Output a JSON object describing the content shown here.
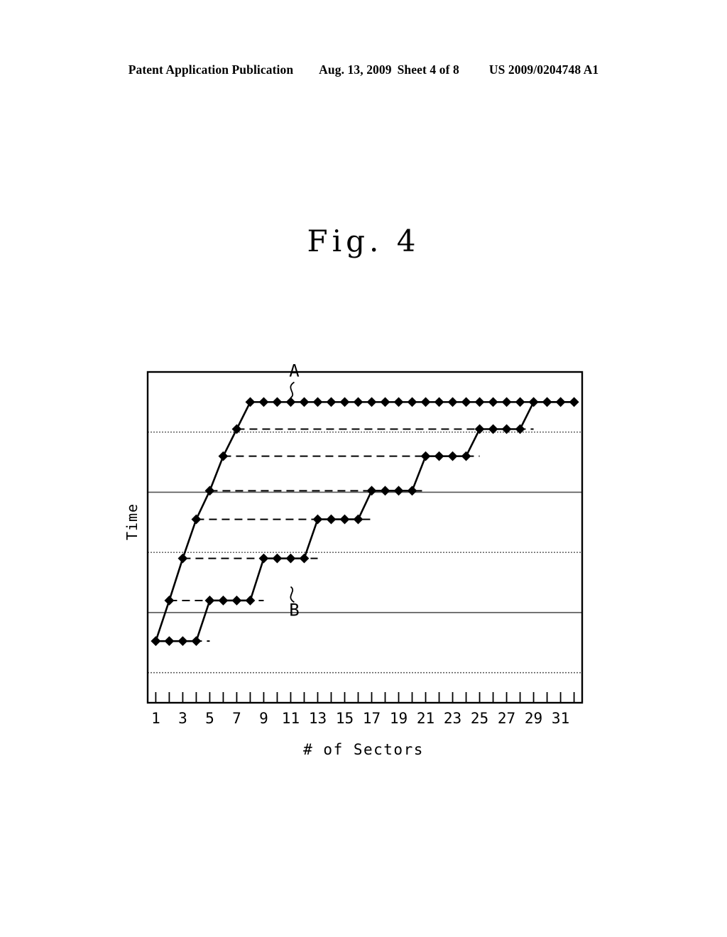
{
  "header": {
    "publication": "Patent Application Publication",
    "date": "Aug. 13, 2009",
    "sheet": "Sheet 4 of 8",
    "patent_number": "US 2009/0204748 A1"
  },
  "figure": {
    "title": "Fig. 4"
  },
  "chart_data": {
    "type": "line",
    "title": "Fig. 4",
    "xlabel": "# of Sectors",
    "ylabel": "Time",
    "xlim": [
      0.4,
      32.6
    ],
    "ylim": [
      0,
      11
    ],
    "grid": true,
    "grid_y": [
      1,
      3,
      5,
      7,
      9
    ],
    "xticks": [
      1,
      2,
      3,
      4,
      5,
      6,
      7,
      8,
      9,
      10,
      11,
      12,
      13,
      14,
      15,
      16,
      17,
      18,
      19,
      20,
      21,
      22,
      23,
      24,
      25,
      26,
      27,
      28,
      29,
      30,
      31,
      32
    ],
    "xticklabels": [
      "1",
      "",
      "3",
      "",
      "5",
      "",
      "7",
      "",
      "9",
      "",
      "11",
      "",
      "13",
      "",
      "15",
      "",
      "17",
      "",
      "19",
      "",
      "21",
      "",
      "23",
      "",
      "25",
      "",
      "27",
      "",
      "29",
      "",
      "31",
      ""
    ],
    "yticks": [],
    "legend": "none",
    "annotations": [
      {
        "label": "A",
        "x": 11,
        "y": 10,
        "text_x": 11,
        "text_y": 10.85,
        "leader": "wavy"
      },
      {
        "label": "B",
        "x": 11,
        "y": 4,
        "text_x": 11,
        "text_y": 3.15,
        "leader": "wavy"
      }
    ],
    "series": [
      {
        "name": "A",
        "marker": "diamond",
        "linestyle": "solid",
        "x": [
          1,
          2,
          3,
          4,
          5,
          6,
          7,
          8,
          9,
          10,
          11,
          12,
          13,
          14,
          15,
          16,
          17,
          18,
          19,
          20,
          21,
          22,
          23,
          24,
          25,
          26,
          27,
          28,
          29,
          30,
          31,
          32
        ],
        "y": [
          2.05,
          3.4,
          4.8,
          6.1,
          7.05,
          8.2,
          9.1,
          10,
          10,
          10,
          10,
          10,
          10,
          10,
          10,
          10,
          10,
          10,
          10,
          10,
          10,
          10,
          10,
          10,
          10,
          10,
          10,
          10,
          10,
          10,
          10,
          10
        ]
      },
      {
        "name": "B",
        "marker": "diamond",
        "linestyle": "solid",
        "x": [
          1,
          2,
          3,
          4,
          5,
          6,
          7,
          8,
          9,
          10,
          11,
          12,
          13,
          14,
          15,
          16,
          17,
          18,
          19,
          20,
          21,
          22,
          23,
          24,
          25,
          26,
          27,
          28,
          29,
          30,
          31,
          32
        ],
        "y": [
          2.05,
          2.05,
          2.05,
          2.05,
          3.4,
          3.4,
          3.4,
          3.4,
          4.8,
          4.8,
          4.8,
          4.8,
          6.1,
          6.1,
          6.1,
          6.1,
          7.05,
          7.05,
          7.05,
          7.05,
          8.2,
          8.2,
          8.2,
          8.2,
          9.1,
          9.1,
          9.1,
          9.1,
          10,
          10,
          10,
          10
        ]
      }
    ],
    "reference_lines": [
      {
        "y": 2.05,
        "from_x": 1,
        "to_x": 5,
        "linestyle": "dashed"
      },
      {
        "y": 3.4,
        "from_x": 2,
        "to_x": 9,
        "linestyle": "dashed"
      },
      {
        "y": 4.8,
        "from_x": 3,
        "to_x": 13,
        "linestyle": "dashed"
      },
      {
        "y": 6.1,
        "from_x": 4,
        "to_x": 17,
        "linestyle": "dashed"
      },
      {
        "y": 7.05,
        "from_x": 5,
        "to_x": 21,
        "linestyle": "dashed"
      },
      {
        "y": 8.2,
        "from_x": 6,
        "to_x": 25,
        "linestyle": "dashed"
      },
      {
        "y": 9.1,
        "from_x": 7,
        "to_x": 29,
        "linestyle": "dashed"
      }
    ]
  },
  "colors": {
    "ink": "#000000",
    "grid": "#555555",
    "background": "#ffffff"
  }
}
